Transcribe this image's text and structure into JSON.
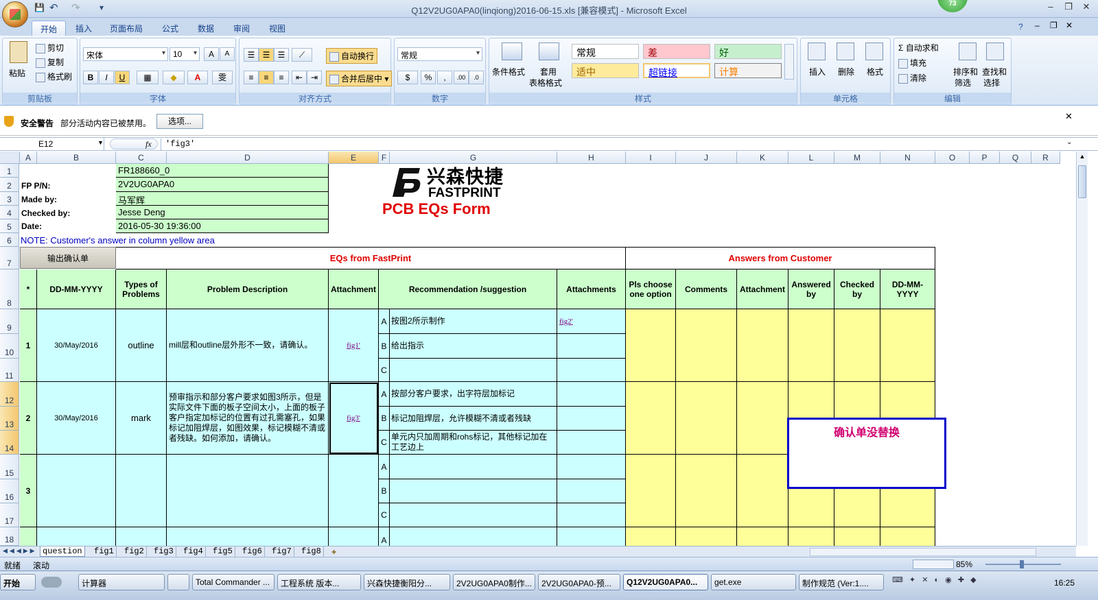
{
  "window": {
    "title": "Q12V2UG0APA0(linqiong)2016-06-15.xls  [兼容模式] - Microsoft Excel",
    "badge": "73"
  },
  "qat": {
    "save": "💾",
    "undo": "↶",
    "redo": "↷",
    "more": "▾"
  },
  "tabs": [
    "开始",
    "插入",
    "页面布局",
    "公式",
    "数据",
    "审阅",
    "视图"
  ],
  "ribbon": {
    "clipboard": {
      "paste": "粘贴",
      "cut": "剪切",
      "copy": "复制",
      "format_painter": "格式刷",
      "label": "剪贴板"
    },
    "font": {
      "family": "宋体",
      "size": "10",
      "bold": "B",
      "italic": "I",
      "underline": "U",
      "label": "字体"
    },
    "alignment": {
      "wrap": "自动换行",
      "merge": "合并后居中",
      "label": "对齐方式"
    },
    "number": {
      "format": "常规",
      "percent": "%",
      "comma": ",",
      "label": "数字"
    },
    "styles": {
      "conditional": "条件格式",
      "table": "套用",
      "table2": "表格格式",
      "label": "样式",
      "cells": [
        {
          "text": "常规",
          "bg": "#ffffff",
          "fg": "#000000"
        },
        {
          "text": "差",
          "bg": "#ffc7ce",
          "fg": "#9c0006"
        },
        {
          "text": "好",
          "bg": "#c6efce",
          "fg": "#006100"
        },
        {
          "text": "适中",
          "bg": "#ffeb9c",
          "fg": "#9c6500"
        },
        {
          "text": "超链接",
          "bg": "#ffffff",
          "fg": "#0000ff"
        },
        {
          "text": "计算",
          "bg": "#f2f2f2",
          "fg": "#fa7d00"
        }
      ]
    },
    "cells": {
      "insert": "插入",
      "delete": "删除",
      "format": "格式",
      "label": "单元格"
    },
    "editing": {
      "autosum": "Σ 自动求和",
      "fill": "填充",
      "clear": "清除",
      "sort": "排序和",
      "sort2": "筛选",
      "find": "查找和",
      "find2": "选择",
      "label": "编辑"
    }
  },
  "security": {
    "title": "安全警告",
    "message": "部分活动内容已被禁用。",
    "button": "选项..."
  },
  "formula": {
    "namebox": "E12",
    "fx": "fx",
    "value": "'fig3'"
  },
  "columns": [
    "A",
    "B",
    "C",
    "D",
    "E",
    "F",
    "G",
    "H",
    "I",
    "J",
    "K",
    "L",
    "M",
    "N",
    "O",
    "P",
    "Q",
    "R"
  ],
  "rows": [
    "1",
    "2",
    "3",
    "4",
    "5",
    "6",
    "7",
    "8",
    "9",
    "10",
    "11",
    "12",
    "13",
    "14",
    "15",
    "16",
    "17",
    "18"
  ],
  "info": {
    "c1": "FR188660_0",
    "fp_label": "FP P/N:",
    "fp": "2V2UG0APA0",
    "made_label": "Made by:",
    "made": "马军辉",
    "checked_label": "Checked by:",
    "checked": "Jesse Deng",
    "date_label": "Date:",
    "date": "2016-05-30 19:36:00",
    "note": "NOTE: Customer's  answer in column yellow area"
  },
  "logo": {
    "cn": "兴森快捷",
    "en": "FASTPRINT",
    "form": "PCB EQs Form"
  },
  "table": {
    "button": "输出确认单",
    "section_fp": "EQs from FastPrint",
    "section_cust": "Answers from Customer",
    "headers": [
      "*",
      "DD-MM-YYYY",
      "Types of Problems",
      "Problem Description",
      "Attachment",
      "Recommendation /suggestion",
      "Attachments",
      "Pls choose one option",
      "Comments",
      "Attachment",
      "Answered by",
      "Checked by",
      "DD-MM-YYYY"
    ],
    "items": [
      {
        "no": "1",
        "date": "30/May/2016",
        "type": "outline",
        "desc": "mill层和outline层外形不一致，请确认。",
        "att": "fig1'",
        "opts": [
          {
            "k": "A",
            "t": "按图2所示制作",
            "a": "fig2'"
          },
          {
            "k": "B",
            "t": "给出指示",
            "a": ""
          },
          {
            "k": "C",
            "t": "",
            "a": ""
          }
        ]
      },
      {
        "no": "2",
        "date": "30/May/2016",
        "type": "mark",
        "desc": "预审指示和部分客户要求如图3所示，但是实际文件下面的板子空间太小，上面的板子客户指定加标记的位置有过孔需塞孔，如果标记加阻焊层，如图效果，标记模糊不清或者残缺。如何添加，请确认。",
        "att": "fig3'",
        "opts": [
          {
            "k": "A",
            "t": "按部分客户要求，出字符层加标记",
            "a": ""
          },
          {
            "k": "B",
            "t": "标记加阻焊层，允许模糊不清或者残缺",
            "a": ""
          },
          {
            "k": "C",
            "t": "单元内只加周期和rohs标记，其他标记加在工艺边上",
            "a": ""
          }
        ]
      },
      {
        "no": "3",
        "date": "",
        "type": "",
        "desc": "",
        "att": "",
        "opts": [
          {
            "k": "A",
            "t": "",
            "a": ""
          },
          {
            "k": "B",
            "t": "",
            "a": ""
          },
          {
            "k": "C",
            "t": "",
            "a": ""
          }
        ]
      }
    ],
    "row18_opt": "A"
  },
  "textbox": "确认单没替换",
  "sheets": [
    "question",
    "fig1",
    "fig2",
    "fig3",
    "fig4",
    "fig5",
    "fig6",
    "fig7",
    "fig8"
  ],
  "status": {
    "ready": "就绪",
    "scroll": "滚动",
    "zoom": "85%"
  },
  "taskbar": {
    "start": "开始",
    "items": [
      "计算器",
      "",
      "Total Commander ...",
      "工程系统  版本...",
      "兴森快捷衡阳分...",
      "2V2UG0APA0制作...",
      "2V2UG0APA0-预...",
      "Q12V2UG0APA0...",
      "get.exe",
      "制作规范 (Ver:1...."
    ],
    "clock": "16:25"
  }
}
